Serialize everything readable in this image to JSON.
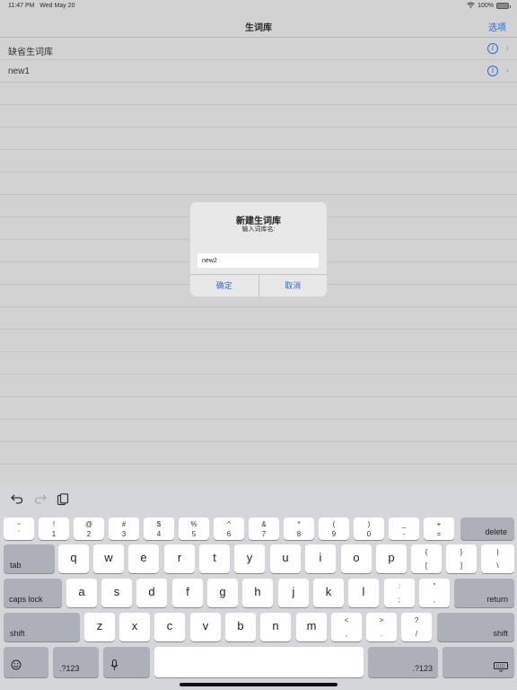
{
  "status": {
    "time": "11:47 PM",
    "date": "Wed May 20",
    "battery": "100%"
  },
  "nav": {
    "title": "生词库",
    "options": "选项"
  },
  "list": [
    {
      "label": "缺省生词库"
    },
    {
      "label": "new1"
    }
  ],
  "alert": {
    "title": "新建生词库",
    "message": "输入词库名:",
    "input_value": "new2",
    "confirm": "确定",
    "cancel": "取消"
  },
  "toolbar": {
    "undo_icon": "undo-icon",
    "redo_icon": "redo-icon",
    "paste_icon": "paste-icon"
  },
  "keyboard": {
    "numbers": [
      {
        "top": "~",
        "bottom": "`"
      },
      {
        "top": "!",
        "bottom": "1"
      },
      {
        "top": "@",
        "bottom": "2"
      },
      {
        "top": "#",
        "bottom": "3"
      },
      {
        "top": "$",
        "bottom": "4"
      },
      {
        "top": "%",
        "bottom": "5"
      },
      {
        "top": "^",
        "bottom": "6"
      },
      {
        "top": "&",
        "bottom": "7"
      },
      {
        "top": "*",
        "bottom": "8"
      },
      {
        "top": "(",
        "bottom": "9"
      },
      {
        "top": ")",
        "bottom": "0"
      },
      {
        "top": "_",
        "bottom": "-"
      },
      {
        "top": "+",
        "bottom": "="
      }
    ],
    "delete": "delete",
    "tab": "tab",
    "row_q": [
      "q",
      "w",
      "e",
      "r",
      "t",
      "y",
      "u",
      "i",
      "o",
      "p"
    ],
    "row_q_extra": [
      {
        "top": "{",
        "bottom": "["
      },
      {
        "top": "}",
        "bottom": "]"
      },
      {
        "top": "|",
        "bottom": "\\"
      }
    ],
    "caps": "caps lock",
    "row_a": [
      "a",
      "s",
      "d",
      "f",
      "g",
      "h",
      "j",
      "k",
      "l"
    ],
    "row_a_extra": [
      {
        "top": ":",
        "bottom": ";"
      },
      {
        "top": "\"",
        "bottom": ","
      }
    ],
    "return": "return",
    "shift": "shift",
    "row_z": [
      "z",
      "x",
      "c",
      "v",
      "b",
      "n",
      "m"
    ],
    "row_z_extra": [
      {
        "top": "<",
        "bottom": ","
      },
      {
        "top": ">",
        "bottom": "."
      },
      {
        "top": "?",
        "bottom": "/"
      }
    ],
    "numkey": ".?123",
    "emoji_icon": "emoji-icon",
    "mic_icon": "mic-icon",
    "hide_icon": "keyboard-hide-icon"
  }
}
